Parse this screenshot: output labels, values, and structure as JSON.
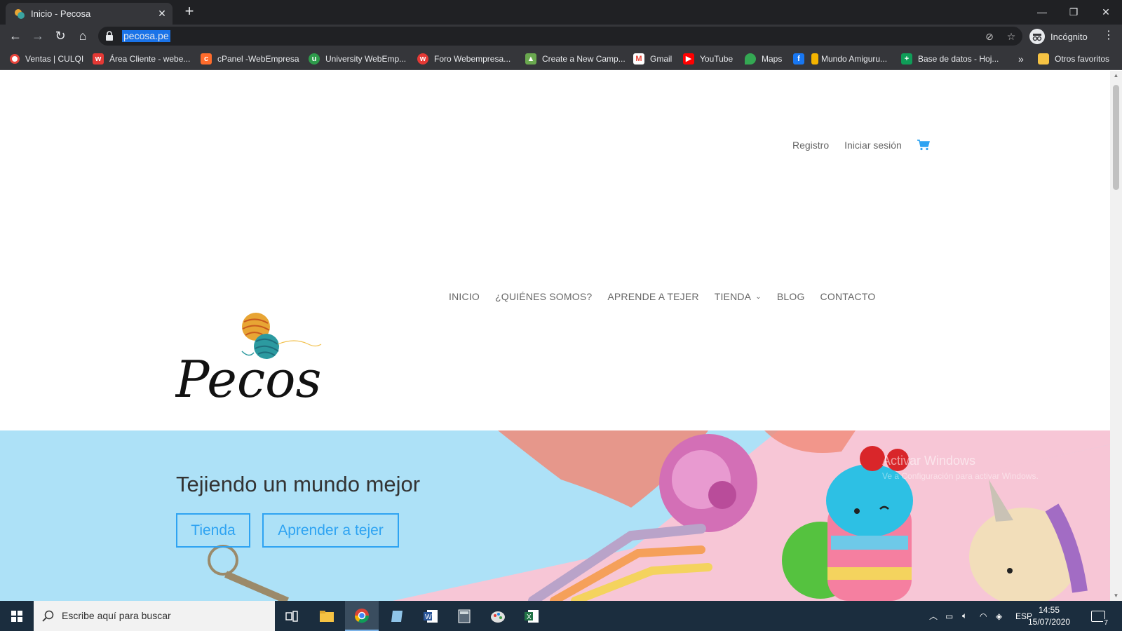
{
  "browser": {
    "tab_title": "Inicio - Pecosa",
    "url": "pecosa.pe",
    "profile_label": "Incógnito",
    "bookmarks": [
      {
        "label": "Ventas | CULQI",
        "color": "#e8453c"
      },
      {
        "label": "Área Cliente - webe...",
        "color": "#e53935"
      },
      {
        "label": "cPanel -WebEmpresa",
        "color": "#ff6c2c"
      },
      {
        "label": "University WebEmp...",
        "color": "#2e9b4b"
      },
      {
        "label": "Foro Webempresa...",
        "color": "#e53935"
      },
      {
        "label": "Create a New Camp...",
        "color": "#6aa84f"
      },
      {
        "label": "Gmail",
        "color": "#ea4335"
      },
      {
        "label": "YouTube",
        "color": "#ff0000"
      },
      {
        "label": "Maps",
        "color": "#34a853"
      },
      {
        "label": "",
        "color": "#1877f2"
      },
      {
        "label": "Mundo Amiguru...",
        "color": "#f4b400"
      },
      {
        "label": "Base de datos - Hoj...",
        "color": "#0f9d58"
      }
    ],
    "overflow_label": "»",
    "other_bookmarks": "Otros favoritos"
  },
  "site": {
    "top_links": {
      "register": "Registro",
      "login": "Iniciar sesión"
    },
    "nav": [
      {
        "label": "INICIO"
      },
      {
        "label": "¿QUIÉNES SOMOS?"
      },
      {
        "label": "APRENDE A TEJER"
      },
      {
        "label": "TIENDA"
      },
      {
        "label": "BLOG"
      },
      {
        "label": "CONTACTO"
      }
    ],
    "logo_text": "Pecosa",
    "hero": {
      "title": "Tejiendo un mundo mejor",
      "btn_shop": "Tienda",
      "btn_learn": "Aprender a tejer"
    },
    "watermark": {
      "line1": "Activar Windows",
      "line2": "Ve a Configuración para activar Windows."
    },
    "colors": {
      "accent": "#2ea3f2",
      "hero_blue": "#ade1f7",
      "hero_pink": "#f7c6d6"
    }
  },
  "taskbar": {
    "search_placeholder": "Escribe aquí para buscar",
    "language": "ESP",
    "time": "14:55",
    "date": "15/07/2020",
    "notification_count": "7"
  }
}
